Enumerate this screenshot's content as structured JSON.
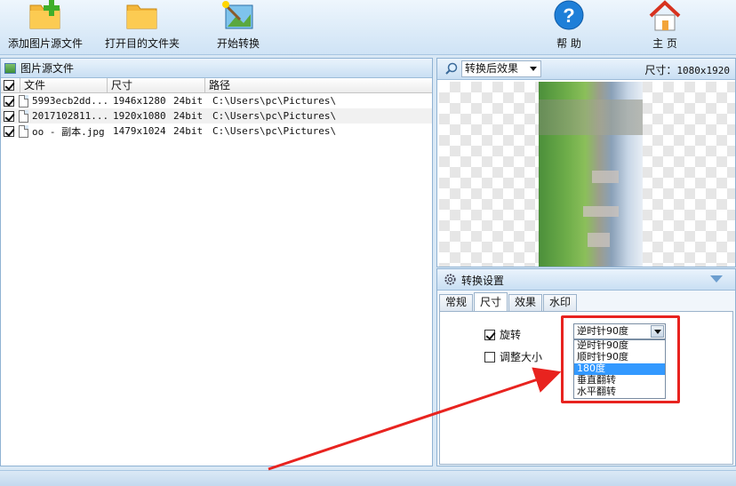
{
  "toolbar": {
    "add_source": "添加图片源文件",
    "open_target": "打开目的文件夹",
    "start_convert": "开始转换",
    "help": "帮 助",
    "home": "主 页"
  },
  "source_panel": {
    "title": "图片源文件",
    "columns": {
      "file": "文件",
      "size": "尺寸",
      "path": "路径"
    },
    "files": [
      {
        "name": "5993ecb2dd...",
        "resolution": "1946x1280",
        "depth": "24bit",
        "path": "C:\\Users\\pc\\Pictures\\",
        "checked": true
      },
      {
        "name": "2017102811...",
        "resolution": "1920x1080",
        "depth": "24bit",
        "path": "C:\\Users\\pc\\Pictures\\",
        "checked": true
      },
      {
        "name": "oo - 副本.jpg",
        "resolution": "1479x1024",
        "depth": "24bit",
        "path": "C:\\Users\\pc\\Pictures\\",
        "checked": true
      }
    ]
  },
  "preview": {
    "mode": "转换后效果",
    "size_label": "尺寸：",
    "size_value": "1080x1920"
  },
  "settings": {
    "title": "转换设置",
    "tabs": [
      "常规",
      "尺寸",
      "效果",
      "水印"
    ],
    "active_tab": "尺寸",
    "rotate_label": "旋转",
    "rotate_checked": true,
    "resize_label": "调整大小",
    "resize_checked": false,
    "rotate_selected": "逆时针90度",
    "rotate_options": [
      "逆时针90度",
      "顺时针90度",
      "180度",
      "垂直翻转",
      "水平翻转"
    ],
    "highlighted_option": "180度"
  },
  "annotation": {
    "highlight_color": "#e8231f"
  }
}
